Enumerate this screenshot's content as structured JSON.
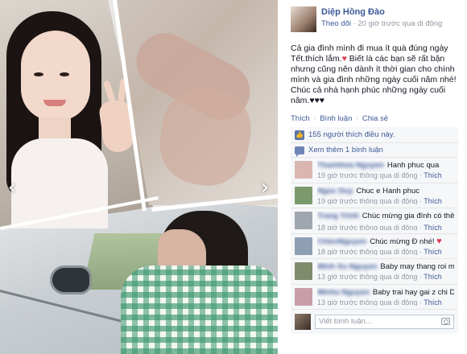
{
  "post": {
    "author": "Diệp Hồng Đào",
    "follow_label": "Theo dõi",
    "meta": "· 20 giờ trước qua di động",
    "caption_part1": "Cả gia đình mình đi mua ít quà đúng ngày Tết.thích lắm.",
    "caption_part2": "Biết là các bạn sẽ rất bận nhưng cũng nên dành ít thời gian cho chính mình và gia đình những ngày cuối năm nhé! Chúc cả nhà hạnh phúc những ngày cuối năm.♥♥♥"
  },
  "actions": {
    "like": "Thích",
    "comment": "Bình luận",
    "share": "Chia sẻ",
    "separator": "·"
  },
  "likes": {
    "text": "155 người thích điều này."
  },
  "more_comments": {
    "text": "Xem thêm 1 bình luận"
  },
  "comments": [
    {
      "name": "Thanhhoa Nguyen",
      "text": "Hanh phuc qua",
      "meta": "19 giờ trước thông qua di động ·",
      "like": "Thích",
      "avatar_color": "#d9b7b0"
    },
    {
      "name": "Ngoc Duy",
      "text": "Chuc e Hanh phuc",
      "meta": "19 giờ trước thông qua di động ·",
      "like": "Thích",
      "avatar_color": "#7a9a6e"
    },
    {
      "name": "Trang Trinh",
      "text": "Chúc mừng gia đình có thêm thành viên",
      "meta": "18 giờ trước thông qua di động ·",
      "like": "Thích",
      "avatar_color": "#a0a6ad",
      "emoji": "smile"
    },
    {
      "name": "ChienNguyen",
      "text": "Chúc mừng Đ nhé!",
      "meta": "18 giờ trước thông qua di động ·",
      "like": "Thích",
      "avatar_color": "#8e9fb3",
      "emoji": "heart"
    },
    {
      "name": "Minh Xu Nguyen",
      "text": "Baby may thang roi m..??",
      "meta": "13 giờ trước thông qua di động ·",
      "like": "Thích",
      "avatar_color": "#7f8c6b"
    },
    {
      "name": "Minha Nguyen",
      "text": "Baby trai hay gai z chi Dao?",
      "meta": "13 giờ trước thông qua di động ·",
      "like": "Thích",
      "avatar_color": "#c79ea8"
    }
  ],
  "write_comment": {
    "placeholder": "Viết bình luận..."
  },
  "icons": {
    "prev": "chevron-left-icon",
    "next": "chevron-right-icon",
    "like": "thumbs-up-icon",
    "comments": "speech-bubble-icon",
    "camera": "camera-icon"
  },
  "colors": {
    "link": "#3b5998",
    "meta": "#9197a3",
    "feed_bg": "#f6f7f9",
    "heart": "#e03a4f"
  }
}
